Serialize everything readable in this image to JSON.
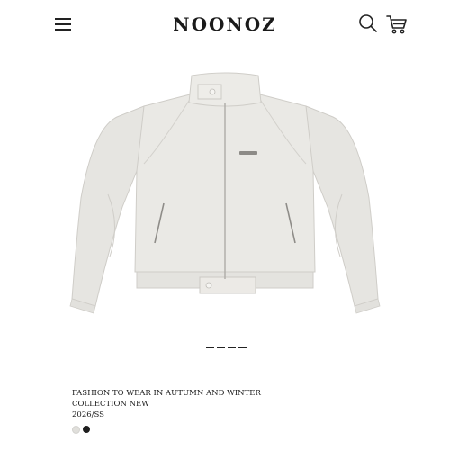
{
  "header": {
    "brand": "NOONOZ",
    "menu_icon": "hamburger-menu-icon",
    "search_icon": "search-icon",
    "cart_icon": "shopping-cart-icon"
  },
  "product": {
    "image": "light-grey-zip-jacket",
    "slide_indicator": "----",
    "title_line1": "FASHION TO WEAR IN AUTUMN AND WINTER",
    "title_line2": "COLLECTION NEW",
    "season": "2026/SS",
    "swatches": [
      {
        "name": "light-grey",
        "color": "#e0dfdb"
      },
      {
        "name": "black",
        "color": "#1e1e1e"
      }
    ]
  }
}
